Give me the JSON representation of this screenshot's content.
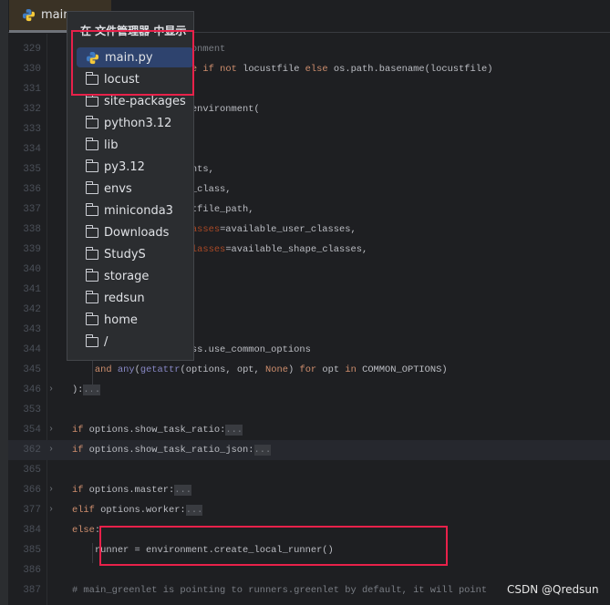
{
  "tab": {
    "label": "main",
    "icon": "python-icon"
  },
  "popup": {
    "title": "在 文件管理器 中显示",
    "items": [
      {
        "label": "main.py",
        "icon": "python-icon",
        "selected": true
      },
      {
        "label": "locust",
        "icon": "folder-icon"
      },
      {
        "label": "site-packages",
        "icon": "folder-icon"
      },
      {
        "label": "python3.12",
        "icon": "folder-icon"
      },
      {
        "label": "lib",
        "icon": "folder-icon"
      },
      {
        "label": "py3.12",
        "icon": "folder-icon"
      },
      {
        "label": "envs",
        "icon": "folder-icon"
      },
      {
        "label": "miniconda3",
        "icon": "folder-icon"
      },
      {
        "label": "Downloads",
        "icon": "folder-icon"
      },
      {
        "label": "StudyS",
        "icon": "folder-icon"
      },
      {
        "label": "storage",
        "icon": "folder-icon"
      },
      {
        "label": "redsun",
        "icon": "folder-icon"
      },
      {
        "label": "home",
        "icon": "folder-icon"
      },
      {
        "label": "/",
        "icon": "folder-icon"
      }
    ]
  },
  "code": [
    {
      "n": "329",
      "t": [
        [
          "                    Environment",
          "cm"
        ]
      ]
    },
    {
      "n": "330",
      "t": [
        [
          "                    = ",
          ""
        ],
        [
          "None",
          "kw"
        ],
        [
          " ",
          ""
        ],
        [
          "if",
          "kw"
        ],
        [
          " ",
          ""
        ],
        [
          "not",
          "kw"
        ],
        [
          " locustfile ",
          ""
        ],
        [
          "else",
          "kw"
        ],
        [
          " os.path.basename(locustfile)",
          ""
        ]
      ]
    },
    {
      "n": "331",
      "t": []
    },
    {
      "n": "332",
      "t": [
        [
          "                    eate_environment(",
          ""
        ]
      ]
    },
    {
      "n": "333",
      "t": [
        [
          "                    ,",
          ""
        ]
      ]
    },
    {
      "n": "334",
      "t": []
    },
    {
      "n": "335",
      "t": [
        [
          "                    t.events,",
          ""
        ]
      ]
    },
    {
      "n": "336",
      "t": [
        [
          "                    shape_class,",
          ""
        ]
      ]
    },
    {
      "n": "337",
      "t": [
        [
          "                    locustfile_path,",
          ""
        ]
      ]
    },
    {
      "n": "338",
      "t": [
        [
          "                    er_classes",
          "kwa"
        ],
        [
          "=available_user_classes,",
          ""
        ]
      ]
    },
    {
      "n": "339",
      "t": [
        [
          "                    ape_classes",
          "kwa"
        ],
        [
          "=available_shape_classes,",
          ""
        ]
      ]
    },
    {
      "n": "340",
      "t": []
    },
    {
      "n": "341",
      "t": []
    },
    {
      "n": "342",
      "t": []
    },
    {
      "n": "343",
      "t": []
    },
    {
      "n": "344",
      "t": [
        [
          "                    e_class.use_common_options",
          ""
        ]
      ]
    },
    {
      "n": "345",
      "t": [
        [
          "        ",
          ""
        ],
        [
          "and",
          "kw"
        ],
        [
          " ",
          ""
        ],
        [
          "any",
          "bi"
        ],
        [
          "(",
          ""
        ],
        [
          "getattr",
          "bi"
        ],
        [
          "(options, opt, ",
          ""
        ],
        [
          "None",
          "kw"
        ],
        [
          ") ",
          ""
        ],
        [
          "for",
          "kw"
        ],
        [
          " opt ",
          ""
        ],
        [
          "in",
          "kw"
        ],
        [
          " COMMON_OPTIONS)",
          ""
        ]
      ]
    },
    {
      "n": "346",
      "fold": true,
      "t": [
        [
          "    ):",
          ""
        ],
        [
          "...",
          "fd"
        ]
      ]
    },
    {
      "n": "353",
      "t": []
    },
    {
      "n": "354",
      "fold": true,
      "t": [
        [
          "    ",
          ""
        ],
        [
          "if",
          "kw"
        ],
        [
          " options.show_task_ratio:",
          ""
        ],
        [
          "...",
          "fd"
        ]
      ]
    },
    {
      "n": "362",
      "fold": true,
      "current": true,
      "t": [
        [
          "    ",
          ""
        ],
        [
          "if",
          "kw"
        ],
        [
          " options.show_task_ratio_json:",
          ""
        ],
        [
          "...",
          "fd"
        ]
      ]
    },
    {
      "n": "365",
      "t": []
    },
    {
      "n": "366",
      "fold": true,
      "t": [
        [
          "    ",
          ""
        ],
        [
          "if",
          "kw"
        ],
        [
          " options.master:",
          ""
        ],
        [
          "...",
          "fd"
        ]
      ]
    },
    {
      "n": "377",
      "fold": true,
      "t": [
        [
          "    ",
          ""
        ],
        [
          "elif",
          "kw"
        ],
        [
          " options.worker:",
          ""
        ],
        [
          "...",
          "fd"
        ]
      ]
    },
    {
      "n": "384",
      "t": [
        [
          "    ",
          ""
        ],
        [
          "else",
          "kw"
        ],
        [
          ":",
          ""
        ]
      ]
    },
    {
      "n": "385",
      "t": [
        [
          "        runner = environment.create_local_runner()",
          ""
        ]
      ]
    },
    {
      "n": "386",
      "t": []
    },
    {
      "n": "387",
      "t": [
        [
          "    # main_greenlet is pointing to runners.greenlet by default, it will point",
          "cm"
        ]
      ]
    }
  ],
  "watermark": "CSDN @Qredsun",
  "colors": {
    "highlight_box": "#e8214a",
    "selection": "#2e436e",
    "keyword": "#cf8e6d"
  }
}
